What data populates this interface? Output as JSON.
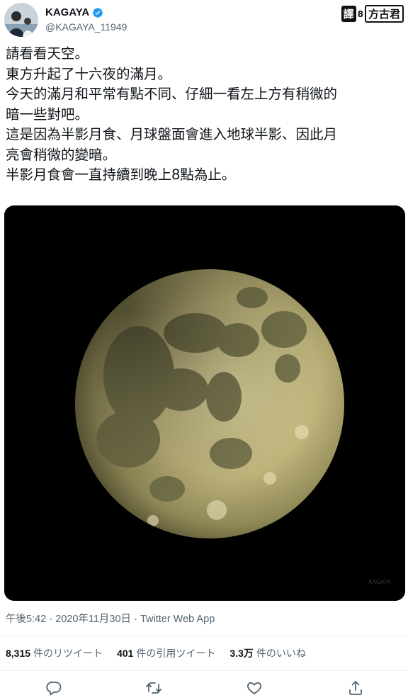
{
  "author": {
    "display_name": "KAGAYA",
    "handle": "@KAGAYA_11949",
    "verified_icon": "verified-badge-icon",
    "avatar_icon": "avatar-photo"
  },
  "translator": {
    "label": "譯",
    "separator": "8",
    "name": "方古君"
  },
  "tweet": {
    "lines": [
      "請看看天空。",
      "東方升起了十六夜的滿月。",
      "今天的滿月和平常有點不同、仔細一看左上方有稍微的",
      "暗一些對吧。",
      "這是因為半影月食、月球盤面會進入地球半影、因此月",
      "亮會稍微的變暗。",
      "半影月食會一直持續到晚上8點為止。"
    ]
  },
  "media": {
    "subject": "full-moon-photo",
    "watermark": "KAGAYA"
  },
  "meta": {
    "time": "午後5:42",
    "sep1": " · ",
    "date": "2020年11月30日",
    "sep2": " · ",
    "source": "Twitter Web App"
  },
  "stats": [
    {
      "count": "8,315",
      "label": "件のリツイート"
    },
    {
      "count": "401",
      "label": "件の引用ツイート"
    },
    {
      "count": "3.3万",
      "label": "件のいいね"
    }
  ],
  "actions": {
    "reply_icon": "reply-icon",
    "retweet_icon": "retweet-icon",
    "like_icon": "like-heart-icon",
    "share_icon": "share-icon"
  },
  "colors": {
    "verified": "#1d9bf0",
    "secondary_text": "#536471",
    "primary_text": "#0f1419"
  }
}
